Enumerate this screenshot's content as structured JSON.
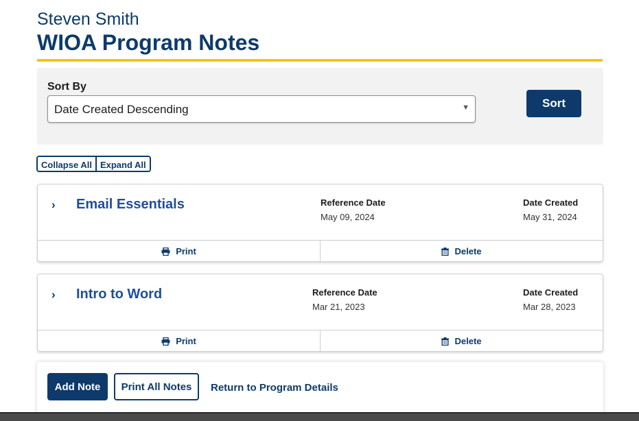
{
  "header": {
    "user_name": "Steven Smith",
    "page_title": "WIOA Program Notes",
    "accent_color": "#f5c518",
    "brand_color": "#0d3a6b"
  },
  "sort": {
    "label": "Sort By",
    "selected_option": "Date Created Descending",
    "button_label": "Sort"
  },
  "toggles": {
    "collapse_label": "Collapse All",
    "expand_label": "Expand All"
  },
  "notes": [
    {
      "title": "Email Essentials",
      "reference_date_label": "Reference Date",
      "reference_date": "May 09, 2024",
      "date_created_label": "Date Created",
      "date_created": "May 31, 2024",
      "print_label": "Print",
      "delete_label": "Delete"
    },
    {
      "title": "Intro to Word",
      "reference_date_label": "Reference Date",
      "reference_date": "Mar 21, 2023",
      "date_created_label": "Date Created",
      "date_created": "Mar 28, 2023",
      "print_label": "Print",
      "delete_label": "Delete"
    }
  ],
  "footer": {
    "add_note_label": "Add Note",
    "print_all_label": "Print All Notes",
    "return_label": "Return to Program Details"
  },
  "icons": {
    "expand": "chevron-right-icon",
    "print": "printer-icon",
    "delete": "trash-icon",
    "select": "caret-down-icon"
  }
}
